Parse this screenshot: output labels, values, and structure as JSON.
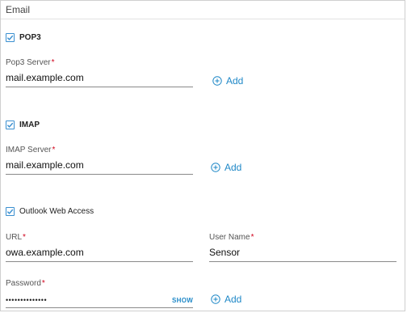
{
  "section": {
    "title": "Email"
  },
  "pop3": {
    "checkbox_label": "POP3",
    "checked": true,
    "server_label": "Pop3 Server",
    "server_value": "mail.example.com",
    "add_label": "Add"
  },
  "imap": {
    "checkbox_label": "IMAP",
    "checked": true,
    "server_label": "IMAP Server",
    "server_value": "mail.example.com",
    "add_label": "Add"
  },
  "owa": {
    "checkbox_label": "Outlook Web Access",
    "checked": true,
    "url_label": "URL",
    "url_value": "owa.example.com",
    "username_label": "User Name",
    "username_value": "Sensor",
    "password_label": "Password",
    "password_value": "••••••••••••••",
    "show_label": "SHOW",
    "add_label": "Add"
  },
  "required_mark": "*",
  "colors": {
    "accent": "#1f88c7",
    "required": "#d0021b",
    "checkbox": "#3a8fd0"
  }
}
